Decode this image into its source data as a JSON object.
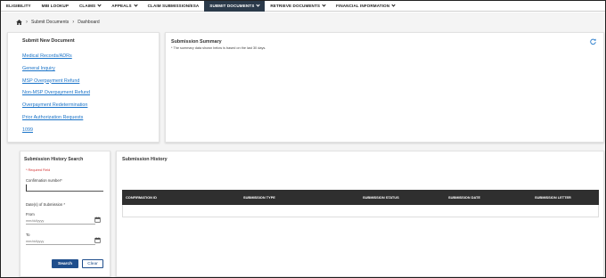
{
  "nav": {
    "items": [
      {
        "label": "ELIGIBILITY",
        "chevron": false,
        "active": false
      },
      {
        "label": "MBI LOOKUP",
        "chevron": false,
        "active": false
      },
      {
        "label": "CLAIMS",
        "chevron": true,
        "active": false
      },
      {
        "label": "APPEALS",
        "chevron": true,
        "active": false
      },
      {
        "label": "CLAIM SUBMISSION/ESA",
        "chevron": false,
        "active": false
      },
      {
        "label": "SUBMIT DOCUMENTS",
        "chevron": true,
        "active": true
      },
      {
        "label": "RETRIEVE DOCUMENTS",
        "chevron": true,
        "active": false
      },
      {
        "label": "FINANCIAL INFORMATION",
        "chevron": true,
        "active": false
      }
    ]
  },
  "breadcrumb": {
    "home_icon": "home-icon",
    "items": [
      "Submit Documents",
      "Dashboard"
    ]
  },
  "submit_new": {
    "title": "Submit New Document",
    "links": [
      "Medical Records/ADRs",
      "General Inquiry",
      "MSP Overpayment Refund",
      "Non-MSP Overpayment Refund",
      "Overpayment Redetermination",
      "Prior Authorization Requests",
      "1099"
    ]
  },
  "summary": {
    "title": "Submission Summary",
    "note": "* The summary data shown below is based on the last 30 days.",
    "refresh_icon": "refresh-icon"
  },
  "search": {
    "title": "Submission History Search",
    "required_note": "* Required Field",
    "confirmation_label": "Confirmation number*",
    "confirmation_value": "",
    "dates_label": "Date(s) of Submission *",
    "from_label": "From",
    "from_placeholder": "mm/dd/yyyy",
    "to_label": "To",
    "to_placeholder": "mm/dd/yyyy",
    "search_button": "Search",
    "clear_button": "Clear",
    "calendar_icon": "calendar-icon"
  },
  "history": {
    "title": "Submission History",
    "columns": [
      "CONFIRMATION ID",
      "SUBMISSION TYPE",
      "SUBMISSION STATUS",
      "SUBMISSION DATE",
      "SUBMISSION LETTER"
    ]
  },
  "colors": {
    "active_nav": "#2b3a4a",
    "link": "#1a73c8",
    "primary_button": "#1f4e8c",
    "table_header": "#2f2f2f",
    "required": "#d32f2f"
  }
}
